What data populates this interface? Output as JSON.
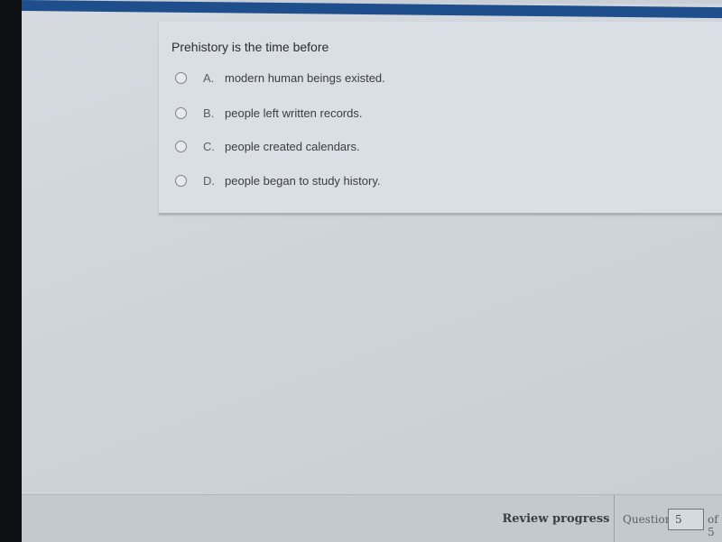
{
  "question": {
    "text": "Prehistory is the time before",
    "options": [
      {
        "letter": "A.",
        "text": "modern human beings existed."
      },
      {
        "letter": "B.",
        "text": "people left written records."
      },
      {
        "letter": "C.",
        "text": "people created calendars."
      },
      {
        "letter": "D.",
        "text": "people began to study history."
      }
    ]
  },
  "footer": {
    "review_label": "Review progress",
    "question_label": "Question",
    "question_number": "5",
    "of_label": "of 5"
  },
  "colors": {
    "topbar": "#1e4e8c"
  }
}
